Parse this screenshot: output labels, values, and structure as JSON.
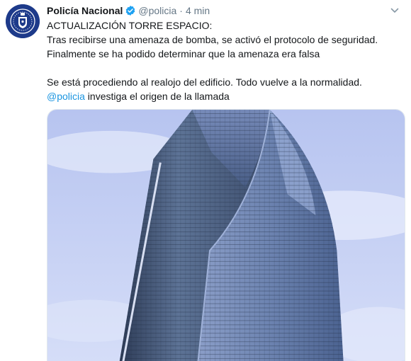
{
  "tweet": {
    "author_name": "Policía Nacional",
    "handle": "@policia",
    "separator": "·",
    "time": "4 min",
    "lines": [
      "ACTUALIZACIÓN TORRE ESPACIO:",
      "Tras recibirse una amenaza de bomba, se activó el protocolo de seguridad.",
      "Finalmente se ha podido determinar que la amenaza era falsa"
    ],
    "line2": "Se está procediendo al realojo del edificio. Todo vuelve a la normalidad.",
    "mention": "@policia",
    "mention_rest": " investiga el origen de la llamada"
  },
  "icons": {
    "avatar": "police-badge-avatar",
    "verified": "verified-badge-icon",
    "menu": "chevron-down-icon"
  },
  "colors": {
    "text": "#14171a",
    "muted": "#657786",
    "link": "#1b95e0",
    "verified": "#1da1f2",
    "avatar_bg": "#1d3a8a"
  }
}
